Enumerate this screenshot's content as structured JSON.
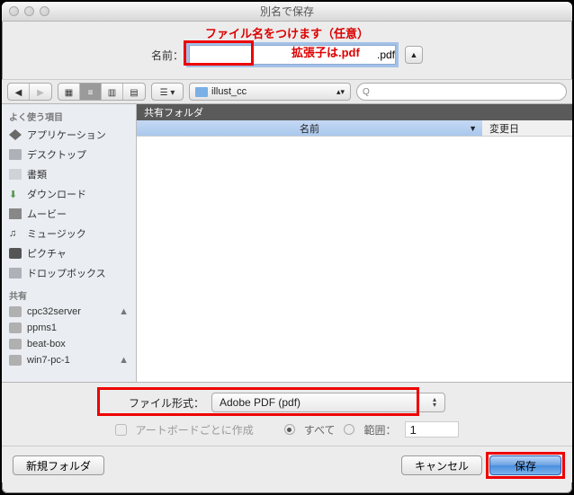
{
  "window_title": "別名で保存",
  "annotations": {
    "filename_hint": "ファイル名をつけます（任意）",
    "ext_hint": "拡張子は.pdf"
  },
  "name_row": {
    "label": "名前：",
    "value": ".pdf",
    "expand": "▲"
  },
  "toolbar": {
    "back": "◀",
    "fwd": "▶",
    "path_folder": "illust_cc",
    "path_arrows": "▴▾",
    "search_icon": "🔍"
  },
  "sidebar": {
    "fav_header": "よく使う項目",
    "fav_items": [
      {
        "label": "アプリケーション",
        "icon": "apps"
      },
      {
        "label": "デスクトップ",
        "icon": "folder"
      },
      {
        "label": "書類",
        "icon": "doc"
      },
      {
        "label": "ダウンロード",
        "icon": "dl"
      },
      {
        "label": "ムービー",
        "icon": "movie"
      },
      {
        "label": "ミュージック",
        "icon": "music"
      },
      {
        "label": "ピクチャ",
        "icon": "pic"
      },
      {
        "label": "ドロップボックス",
        "icon": "folder"
      }
    ],
    "shared_header": "共有",
    "shared_items": [
      {
        "label": "cpc32server"
      },
      {
        "label": "ppms1"
      },
      {
        "label": "beat-box"
      },
      {
        "label": "win7-pc-1"
      }
    ],
    "eject": "▲"
  },
  "content": {
    "shared_bar": "共有フォルダ",
    "col_name": "名前",
    "col_date": "変更日",
    "sort_arrow": "▼"
  },
  "bottom": {
    "format_label": "ファイル形式：",
    "format_value": "Adobe PDF (pdf)",
    "dd_arrows": "▴\n▾",
    "artboard_chk": "アートボードごとに作成",
    "all": "すべて",
    "range": "範囲：",
    "range_value": "1",
    "new_folder": "新規フォルダ",
    "cancel": "キャンセル",
    "save": "保存"
  }
}
